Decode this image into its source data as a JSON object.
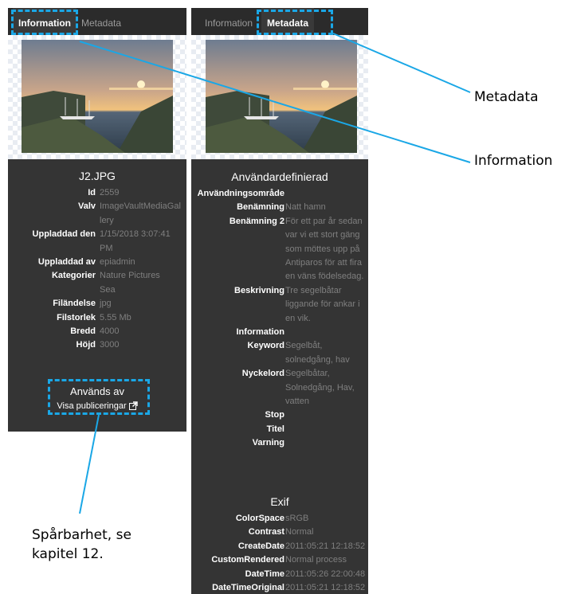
{
  "left_panel": {
    "tabs": [
      "Information",
      "Metadata"
    ],
    "file_title": "J2.JPG",
    "fields": [
      {
        "label": "Id",
        "value": [
          "2559"
        ]
      },
      {
        "label": "Valv",
        "value": [
          "ImageVaultMediaGal",
          "lery"
        ]
      },
      {
        "label": "Uppladdad den",
        "value": [
          "1/15/2018 3:07:41",
          "PM"
        ]
      },
      {
        "label": "Uppladdad av",
        "value": [
          "epiadmin"
        ]
      },
      {
        "label": "Kategorier",
        "value": [
          "Nature Pictures",
          "Sea"
        ]
      },
      {
        "label": "Filändelse",
        "value": [
          "jpg"
        ]
      },
      {
        "label": "Filstorlek",
        "value": [
          "5.55 Mb"
        ]
      },
      {
        "label": "Bredd",
        "value": [
          "4000"
        ]
      },
      {
        "label": "Höjd",
        "value": [
          "3000"
        ]
      }
    ],
    "used_by_title": "Används av",
    "used_by_link": "Visa publiceringar"
  },
  "right_panel": {
    "tabs": [
      "Information",
      "Metadata"
    ],
    "section_user": "Användardefinierad",
    "user_fields": [
      {
        "label": "Användningsområde",
        "value": []
      },
      {
        "label": "Benämning",
        "value": [
          "Natt hamn"
        ]
      },
      {
        "label": "Benämning 2",
        "value": [
          "För ett par år sedan",
          "var vi ett stort gäng",
          "som möttes upp på",
          "Antiparos för att fira",
          "en väns födelsedag."
        ]
      },
      {
        "label": "Beskrivning",
        "value": [
          "Tre segelbåtar",
          "liggande för ankar i",
          "en vik."
        ]
      },
      {
        "label": "Information",
        "value": []
      },
      {
        "label": "Keyword",
        "value": [
          "Segelbåt,",
          "solnedgång, hav"
        ]
      },
      {
        "label": "Nyckelord",
        "value": [
          "Segelbåtar,",
          "Solnedgång, Hav,",
          "vatten"
        ]
      },
      {
        "label": "Stop",
        "value": []
      },
      {
        "label": "Titel",
        "value": []
      },
      {
        "label": "Varning",
        "value": []
      }
    ],
    "section_exif": "Exif",
    "exif_fields": [
      {
        "label": "ColorSpace",
        "value": [
          "sRGB"
        ]
      },
      {
        "label": "Contrast",
        "value": [
          "Normal"
        ]
      },
      {
        "label": "CreateDate",
        "value": [
          "2011:05:21 12:18:52"
        ]
      },
      {
        "label": "CustomRendered",
        "value": [
          "Normal process"
        ]
      },
      {
        "label": "DateTime",
        "value": [
          "2011:05:26 22:00:48"
        ]
      },
      {
        "label": "DateTimeOriginal",
        "value": [
          "2011:05:21 12:18:52"
        ]
      }
    ]
  },
  "callouts": {
    "metadata": "Metadata",
    "information": "Information",
    "traceability": [
      "Spårbarhet, se",
      "kapitel 12."
    ]
  },
  "colors": {
    "accent": "#1aa7e6",
    "panel": "#343434",
    "value_text": "#7f7f7f"
  }
}
